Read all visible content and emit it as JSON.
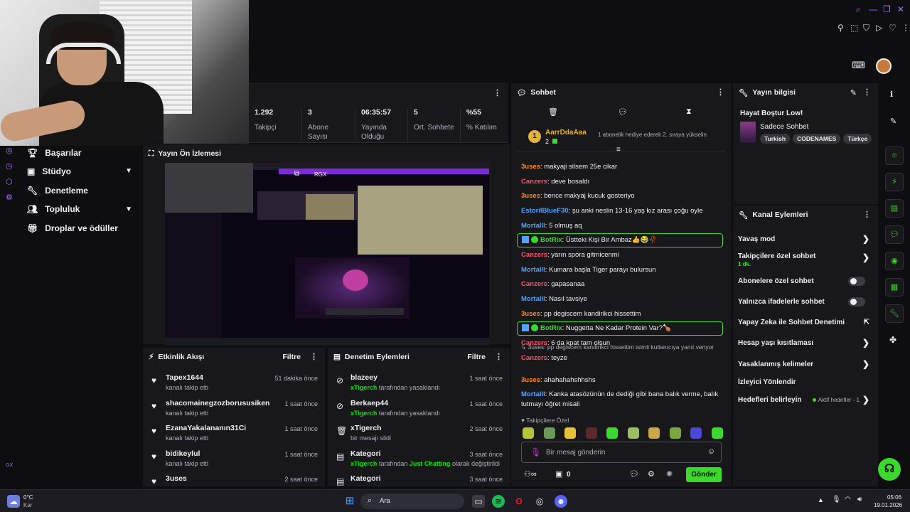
{
  "stats": [
    {
      "value": "1.292",
      "label": "Takipçi"
    },
    {
      "value": "3",
      "label": "Abone Sayısı"
    },
    {
      "value": "06:35:57",
      "label": "Yayında Olduğu"
    },
    {
      "value": "5",
      "label": "Ort. Sohbete"
    },
    {
      "value": "%55",
      "label": "% Katılım"
    }
  ],
  "sidebar": {
    "items": [
      {
        "label": "Başarılar",
        "icon": "trophy-icon"
      },
      {
        "label": "Stüdyo",
        "icon": "studio-icon"
      },
      {
        "label": "Denetleme",
        "icon": "wrench-icon"
      },
      {
        "label": "Topluluk",
        "icon": "people-icon"
      },
      {
        "label": "Droplar ve ödüller",
        "icon": "gift-icon"
      }
    ],
    "bottom_label": "GX"
  },
  "preview": {
    "title": "Yayın Ön İzlemesi",
    "overlay_text": "RGX"
  },
  "activity": {
    "title": "Etkinlik Akışı",
    "filter": "Filtre",
    "items": [
      {
        "name": "Tapex1644",
        "sub": "kanalı takip etti",
        "time": "51 dakika önce"
      },
      {
        "name": "shacomainegzozborususiken",
        "sub": "kanalı takip etti",
        "time": "1 saat önce"
      },
      {
        "name": "EzanaYakalananın31Ci",
        "sub": "kanalı takip etti",
        "time": "1 saat önce"
      },
      {
        "name": "bidikeylul",
        "sub": "kanalı takip etti",
        "time": "1 saat önce"
      },
      {
        "name": "3uses",
        "sub": "",
        "time": "2 saat önce"
      }
    ]
  },
  "modlog": {
    "title": "Denetim Eylemleri",
    "filter": "Filtre",
    "items": [
      {
        "name": "blazeey",
        "actor": "xTigerch",
        "sub": "tarafından yasaklandı",
        "time": "1 saat önce"
      },
      {
        "name": "Berkaep44",
        "actor": "xTigerch",
        "sub": "tarafından yasaklandı",
        "time": "1 saat önce"
      },
      {
        "name": "xTigerch",
        "actor": "",
        "sub": "bir mesajı sildi",
        "time": "2 saat önce"
      },
      {
        "name": "Kategori",
        "actor": "xTigerch",
        "sub": "tarafından",
        "sub_highlight": "Just Chatting",
        "sub_end": "olarak değiştirildi",
        "time": "3 saat önce"
      },
      {
        "name": "Kategori",
        "actor": "",
        "sub": "",
        "time": "3 saat önce"
      }
    ]
  },
  "chat": {
    "title": "Sohbet",
    "hype_user": "AarrDdaAaa",
    "hype_badge": "1",
    "hype_count": "2",
    "hype_text": "1 abonelik hediye ederek 2. sıraya yükselin",
    "messages": [
      {
        "user": "3uses",
        "color": "#ff8c1a",
        "text": "makyaji silsem 25e cikar"
      },
      {
        "user": "Canzers",
        "color": "#ff4f6d",
        "text": "deve bosaldı"
      },
      {
        "user": "3uses",
        "color": "#ff8c1a",
        "text": "bence makyaj kucuk gosteriyo"
      },
      {
        "user": "EstorilBlueF30",
        "color": "#4fa3ff",
        "text": "şu anki neslin 13-16 yaş kız arası çoğu oyle"
      },
      {
        "user": "Mortalll",
        "color": "#4fa3ff",
        "text": "5 olmuş aq"
      },
      {
        "user": "BotRix",
        "color": "#3bd82d",
        "text": "Üstteki Kişi Bir Ambaz👍😂🥀",
        "bot": true
      },
      {
        "user": "Canzers",
        "color": "#ff4f6d",
        "text": "yarın spora gitmicenmi"
      },
      {
        "user": "Mortalll",
        "color": "#4fa3ff",
        "text": "Kumara başla Tiger parayı bulursun"
      },
      {
        "user": "Canzers",
        "color": "#ff4f6d",
        "text": "gapasanaa"
      },
      {
        "user": "Mortalll",
        "color": "#4fa3ff",
        "text": "Nasıl tavsiye"
      },
      {
        "user": "3uses",
        "color": "#ff8c1a",
        "text": "pp degiscem kandirikci hissettim"
      },
      {
        "user": "BotRix",
        "color": "#3bd82d",
        "text": "Nuggetta Ne Kadar Protein Var?🍗",
        "bot": true
      },
      {
        "user": "Canzers",
        "color": "#ff4f6d",
        "text": "6 da kpat tam olsun"
      },
      {
        "user": "Canzers",
        "color": "#ff4f6d",
        "text": "teyze",
        "reply": "3uses: pp degiscem kandirikci hissettim isimli kullanıcıya yanıt veriyor"
      },
      {
        "user": "3uses",
        "color": "#ff8c1a",
        "text": "ahahahahshhshs"
      },
      {
        "user": "Mortalll",
        "color": "#4fa3ff",
        "text": "Kanka atasözünün de dediği gibi bana balık verme, balık tutmayı öğret misali"
      }
    ],
    "followers_only": "Takipçilere Özel",
    "input_placeholder": "Bir mesaj gönderin",
    "viewer_count": "0",
    "send_label": "Gönder"
  },
  "streaminfo": {
    "title": "Yayın bilgisi",
    "stream_title": "Hayat Boştur Low!",
    "category": "Sadece Sohbet",
    "tags": [
      "Turkish",
      "CODENAMES",
      "Türkçe"
    ]
  },
  "channel_actions": {
    "title": "Kanal Eylemleri",
    "items": [
      {
        "label": "Yavaş mod",
        "type": "chevron"
      },
      {
        "label": "Takipçilere özel sohbet",
        "sub": "1 dk.",
        "type": "chevron"
      },
      {
        "label": "Abonelere özel sohbet",
        "type": "toggle"
      },
      {
        "label": "Yalnızca ifadelerle sohbet",
        "type": "toggle"
      },
      {
        "label": "Yapay Zeka ile Sohbet Denetimi",
        "type": "external"
      },
      {
        "label": "Hesap yaşı kısıtlaması",
        "type": "chevron"
      },
      {
        "label": "Yasaklanmış kelimeler",
        "type": "chevron"
      },
      {
        "label": "İzleyici Yönlendir",
        "type": "none"
      },
      {
        "label": "Hedefleri belirleyin",
        "status": "Aktif hedefler - 1",
        "type": "chevron"
      }
    ]
  },
  "taskbar": {
    "weather_temp": "0°C",
    "weather_text": "Kar",
    "search_placeholder": "Ara",
    "time": "05:06",
    "date": "19.01.2026"
  },
  "colors": {
    "accent_green": "#3bd82d",
    "accent_purple": "#a970ff",
    "panel_bg": "#18181b",
    "page_bg": "#0e0e10"
  }
}
